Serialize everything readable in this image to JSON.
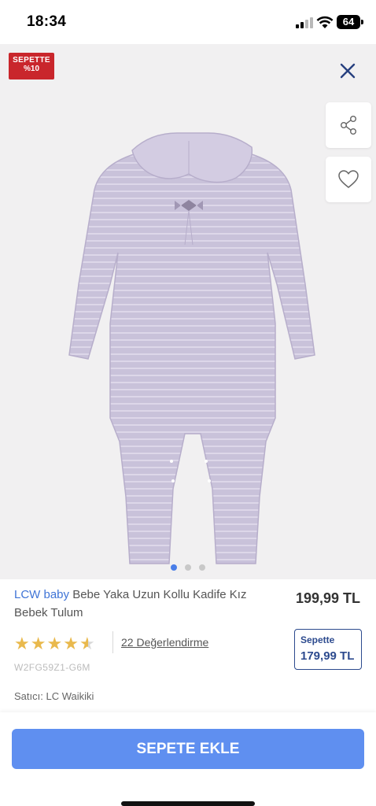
{
  "status_bar": {
    "time": "18:34",
    "battery": "64",
    "icons": [
      "signal-icon",
      "wifi-icon",
      "battery-icon"
    ]
  },
  "gallery": {
    "promo_badge_line1": "SEPETTE",
    "promo_badge_line2": "%10",
    "active_slide": 1,
    "slide_count": 3,
    "icons": [
      "close-icon",
      "share-icon",
      "heart-icon"
    ]
  },
  "product": {
    "brand": "LCW baby",
    "title": "Bebe Yaka Uzun Kollu Kadife Kız Bebek Tulum",
    "price": "199,99 TL",
    "rating": 4.5,
    "reviews": "22 Değerlendirme",
    "basket_label": "Sepette",
    "basket_price": "179,99 TL",
    "sku": "W2FG59Z1-G6M",
    "seller": "Satıcı: LC Waikiki"
  },
  "actions": {
    "add_to_cart": "SEPETE EKLE"
  },
  "colors": {
    "brand_blue": "#3f74d6",
    "button_blue": "#5f8ff0",
    "badge_red": "#c9262c",
    "basket_navy": "#2c4a8e",
    "star": "#e9b94d"
  }
}
